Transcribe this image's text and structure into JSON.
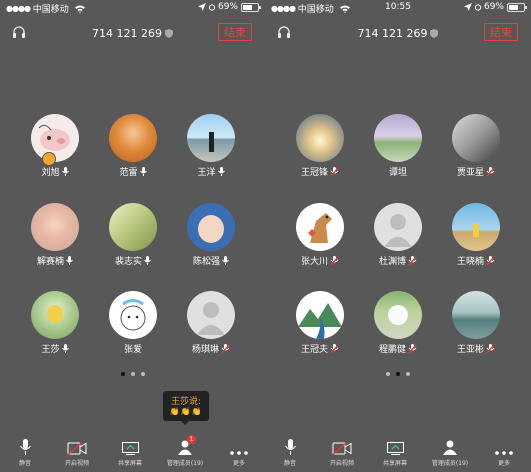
{
  "status": {
    "carrier": "中国移动",
    "left_time": "",
    "right_time": "10:55",
    "battery": "69%"
  },
  "meeting": {
    "id": "714 121 269",
    "end_label": "结束"
  },
  "left_participants": [
    "刘旭",
    "范雷",
    "王洋",
    "解赛楠",
    "裴志实",
    "陈松强",
    "王莎",
    "张爱",
    "杨琪琳"
  ],
  "right_participants": [
    "王冠锋",
    "谭坦",
    "贾亚星",
    "张大川",
    "杜渊博",
    "王晓楠",
    "王冠夫",
    "程鹏健",
    "王亚彬"
  ],
  "toolbar": {
    "mute": "静音",
    "video": "开启视频",
    "share": "共享屏幕",
    "members": "管理成员(19)",
    "more": "更多",
    "badge": "1"
  },
  "tooltip": {
    "title": "王莎说:",
    "emoji": "👏👏👏"
  },
  "colors": {
    "background": "#585858",
    "end_button": "#e1463f",
    "speaking_badge": "#f0a830",
    "notification": "#e53935"
  }
}
